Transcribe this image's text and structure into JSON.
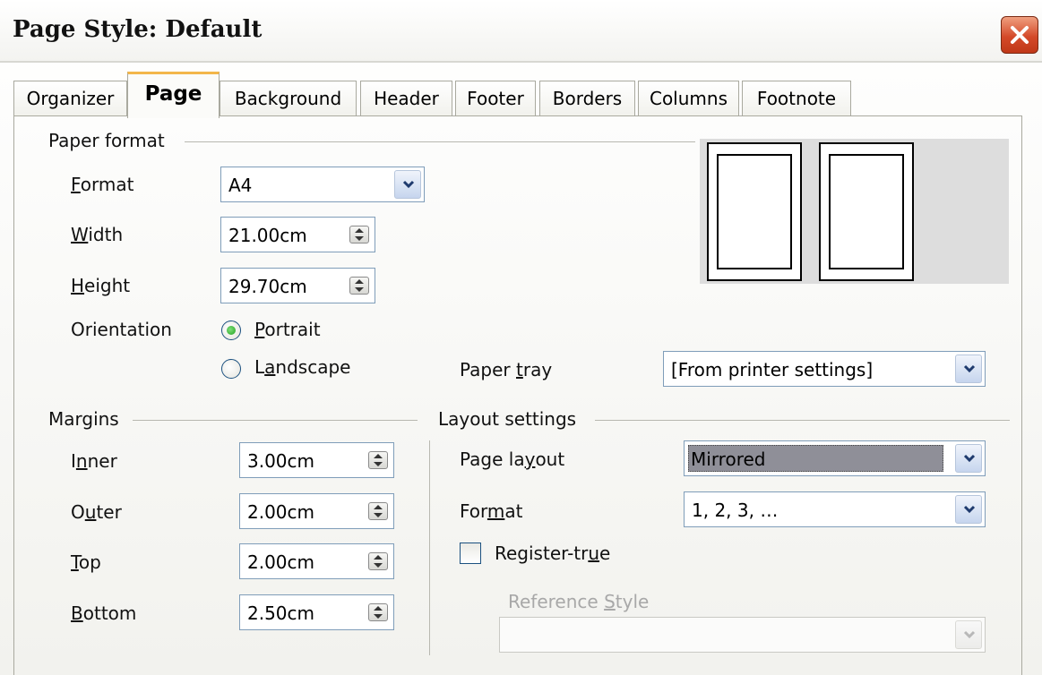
{
  "window": {
    "title": "Page Style: Default"
  },
  "tabs": [
    {
      "label": "Organizer"
    },
    {
      "label": "Page"
    },
    {
      "label": "Background"
    },
    {
      "label": "Header"
    },
    {
      "label": "Footer"
    },
    {
      "label": "Borders"
    },
    {
      "label": "Columns"
    },
    {
      "label": "Footnote"
    }
  ],
  "active_tab": "Page",
  "paper_format": {
    "section_label": "Paper format",
    "format_label": "Format",
    "format_value": "A4",
    "width_label": "Width",
    "width_value": "21.00cm",
    "height_label": "Height",
    "height_value": "29.70cm",
    "orientation_label": "Orientation",
    "portrait_label": "Portrait",
    "landscape_label": "Landscape",
    "orientation_selected": "Portrait",
    "paper_tray_label": "Paper tray",
    "paper_tray_value": "[From printer settings]"
  },
  "margins": {
    "section_label": "Margins",
    "inner_label": "Inner",
    "inner_value": "3.00cm",
    "outer_label": "Outer",
    "outer_value": "2.00cm",
    "top_label": "Top",
    "top_value": "2.00cm",
    "bottom_label": "Bottom",
    "bottom_value": "2.50cm"
  },
  "layout_settings": {
    "section_label": "Layout settings",
    "page_layout_label": "Page layout",
    "page_layout_value": "Mirrored",
    "format_label": "Format",
    "format_value": "1, 2, 3, …",
    "register_true_label": "Register-true",
    "register_true_checked": false,
    "reference_style_label": "Reference Style",
    "reference_style_value": ""
  },
  "colors": {
    "active_tab_accent": "#f3b64a",
    "close_button": "#d44a2a",
    "radio_selected": "#21a121",
    "field_border": "#7f9db9"
  },
  "icons": [
    "close-icon",
    "chevron-down-icon",
    "spin-updown-icon"
  ]
}
